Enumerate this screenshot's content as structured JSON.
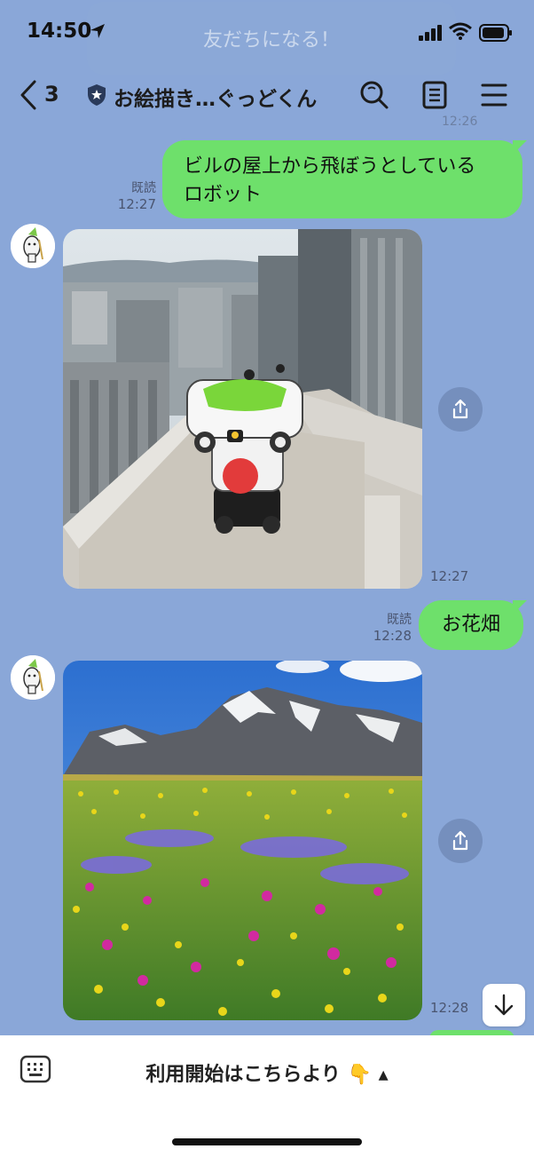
{
  "status_bar": {
    "time": "14:50"
  },
  "banner": {
    "text": "友だちになる！"
  },
  "header": {
    "back_count": "3",
    "title": "お絵描き…ぐっどくん"
  },
  "faded_time": "12:26",
  "messages": [
    {
      "type": "outgoing_text",
      "text_line1": "ビルの屋上から飛ぼうとしている",
      "text_line2": "ロボット",
      "read_label": "既読",
      "time": "12:27"
    },
    {
      "type": "incoming_image",
      "image_alt": "ビルの屋上のロボット",
      "time": "12:27"
    },
    {
      "type": "outgoing_text",
      "text": "お花畑",
      "read_label": "既読",
      "time": "12:28"
    },
    {
      "type": "incoming_image",
      "image_alt": "お花畑と山",
      "time": "12:28"
    }
  ],
  "bottom": {
    "start_label": "利用開始はこちらより 👇 ▴"
  },
  "colors": {
    "chat_bg": "#8aa7d8",
    "outgoing_bubble": "#6ee06b",
    "share_btn": "#6e87b4"
  },
  "icons": [
    "location-arrow-icon",
    "signal-icon",
    "wifi-icon",
    "battery-icon",
    "back-chevron-icon",
    "shield-icon",
    "search-icon",
    "notes-icon",
    "menu-icon",
    "share-icon",
    "arrow-down-icon",
    "keyboard-icon"
  ]
}
